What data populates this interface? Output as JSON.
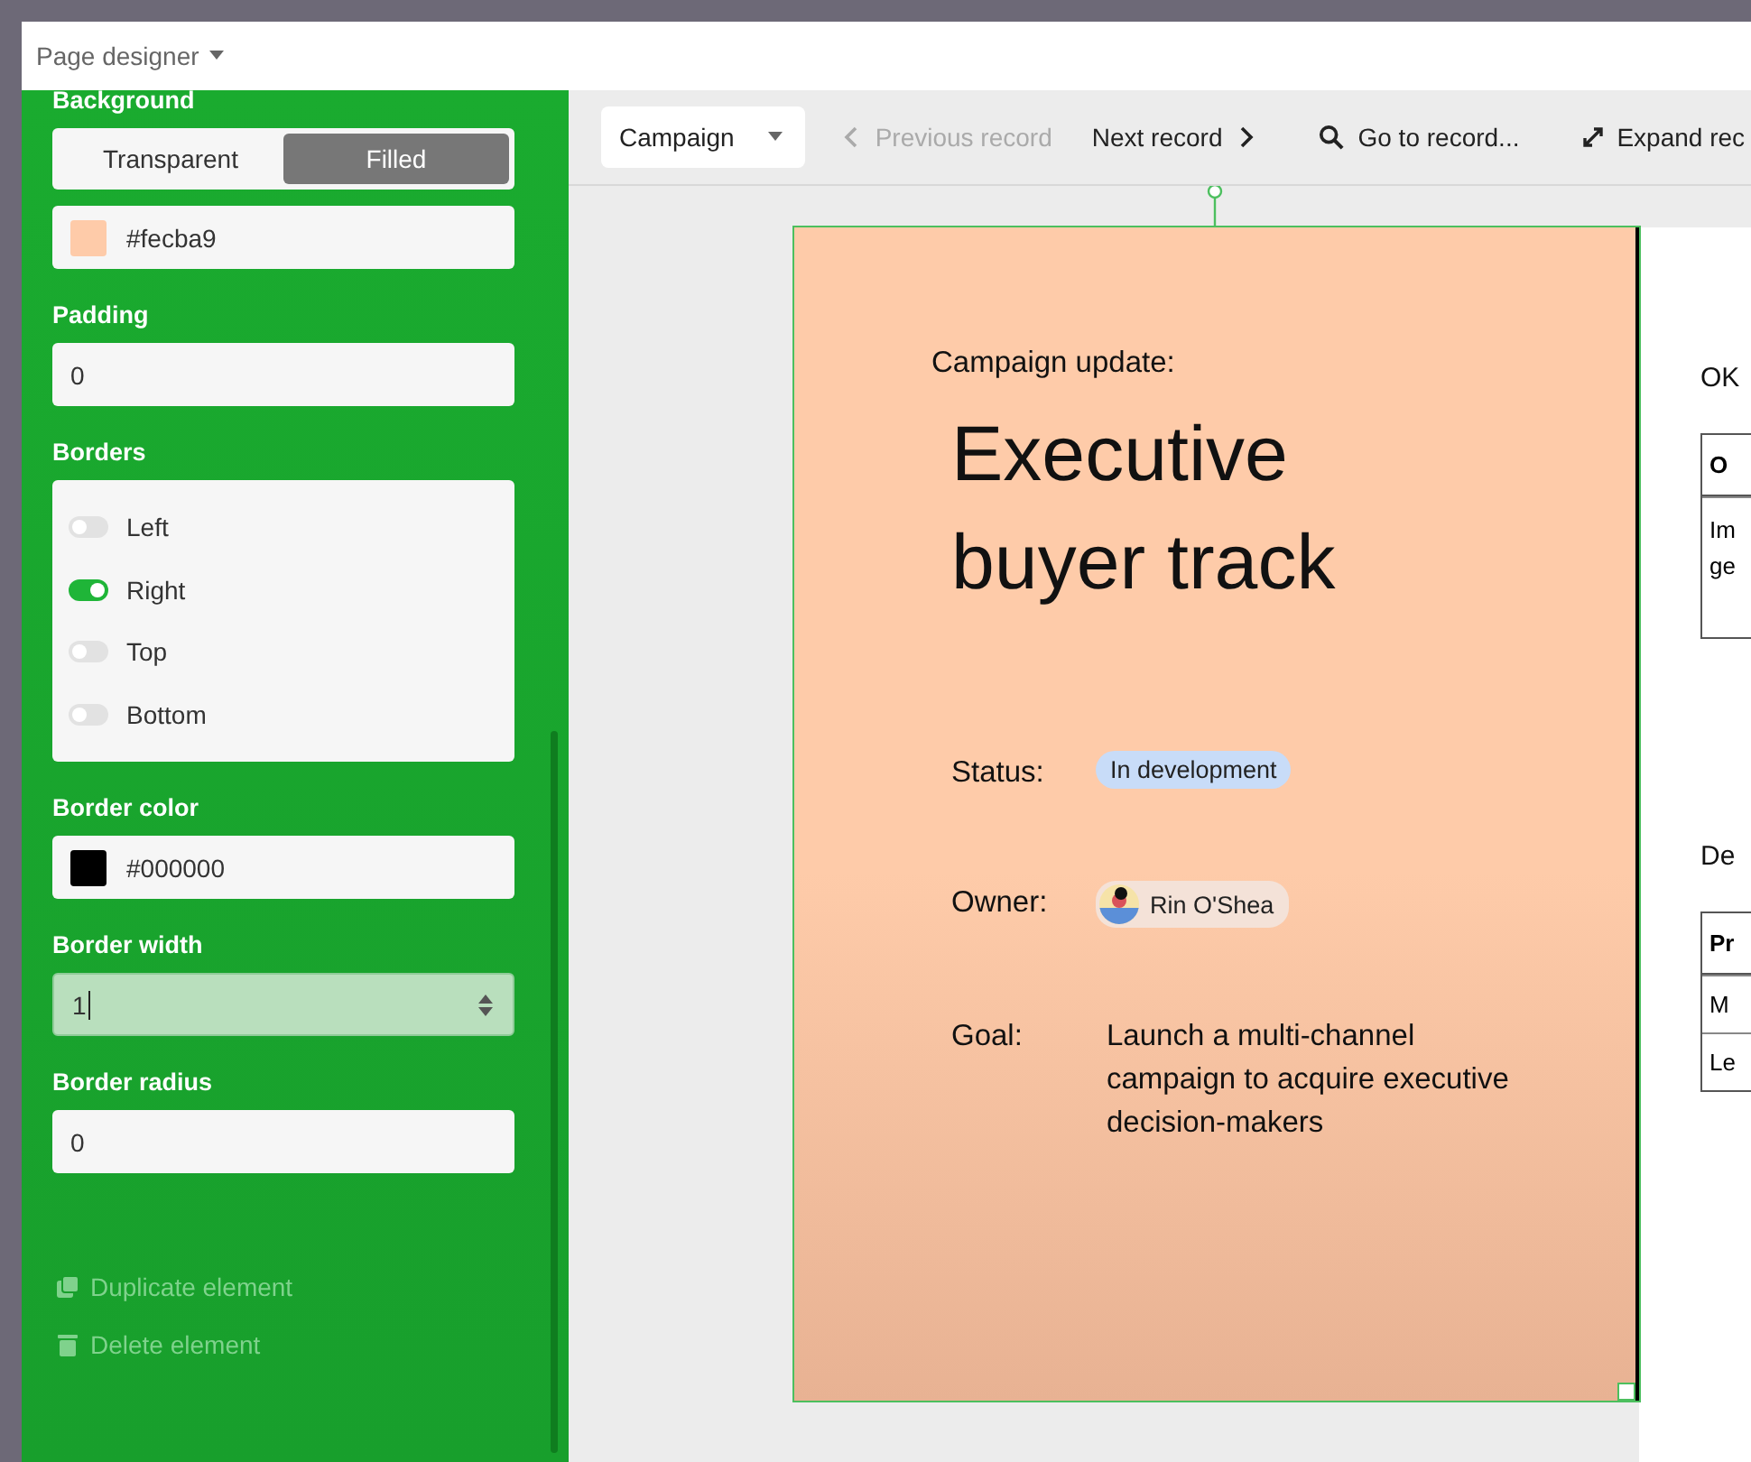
{
  "window": {
    "title": "Page designer"
  },
  "properties": [
    {
      "label": "Background",
      "kind": "segmented",
      "options": [
        {
          "label": "Transparent",
          "selected": false
        },
        {
          "label": "Filled",
          "selected": true
        }
      ]
    },
    {
      "kind": "color",
      "color": "#fecba9",
      "value": "#fecba9"
    },
    {
      "label": "Padding",
      "kind": "number",
      "value": "0",
      "focused": false
    },
    {
      "label": "Borders",
      "kind": "toggles",
      "items": [
        {
          "label": "Left",
          "on": false
        },
        {
          "label": "Right",
          "on": true
        },
        {
          "label": "Top",
          "on": false
        },
        {
          "label": "Bottom",
          "on": false
        }
      ]
    },
    {
      "label": "Border color",
      "kind": "color",
      "color": "#000000",
      "value": "#000000"
    },
    {
      "label": "Border width",
      "kind": "number",
      "value": "1",
      "focused": true
    },
    {
      "label": "Border radius",
      "kind": "number",
      "value": "0",
      "focused": false
    }
  ],
  "actions": [
    {
      "label": "Duplicate element",
      "kind": "duplicate",
      "disabled": true
    },
    {
      "label": "Delete element",
      "kind": "delete",
      "disabled": true
    }
  ],
  "toolbar": {
    "record_type": "Campaign",
    "buttons": [
      {
        "label": "Previous record",
        "kind": "previous",
        "disabled": true
      },
      {
        "label": "Next record",
        "kind": "next",
        "disabled": false
      },
      {
        "label": "Go to record...",
        "kind": "search",
        "disabled": false
      },
      {
        "label": "Expand rec",
        "kind": "expand",
        "disabled": false
      }
    ]
  },
  "card": {
    "heading": "Campaign update:",
    "title": "Executive buyer track",
    "fields": [
      {
        "label": "Status:",
        "kind": "status",
        "value": "In development"
      },
      {
        "label": "Owner:",
        "kind": "person",
        "value": "Rin O'Shea"
      },
      {
        "label": "Goal:",
        "kind": "text",
        "value": "Launch a multi-channel campaign to acquire executive decision-makers"
      }
    ]
  },
  "next_page": {
    "sections": [
      {
        "heading": "OK",
        "header": "O",
        "rows": [
          [
            "Im",
            "ge"
          ]
        ]
      },
      {
        "heading": "De",
        "header": "Pr",
        "rows": [
          [
            "M"
          ],
          [
            "Le"
          ]
        ]
      }
    ]
  }
}
